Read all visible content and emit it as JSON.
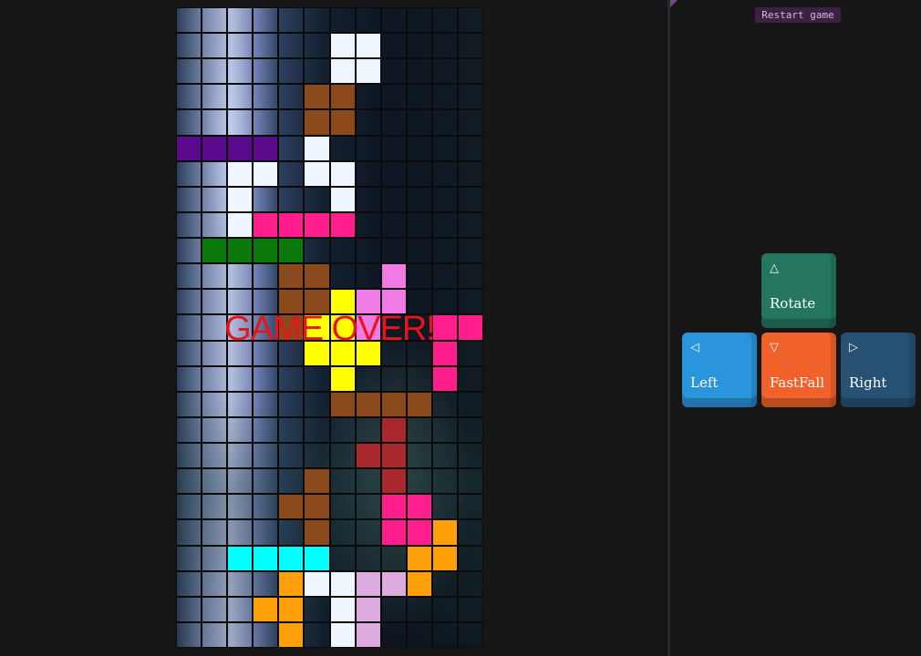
{
  "board": {
    "cols": 12,
    "rows": 25,
    "palette": {
      "W": "#f0f6ff",
      "B": "#8c4a1c",
      "P": "#5c0a8c",
      "M": "#ff1e8c",
      "G": "#0a780a",
      "V": "#f07ae6",
      "Y": "#ffff00",
      "R": "#a8282d",
      "C": "#00ffff",
      "O": "#ffa00a",
      "L": "#dcaadc"
    },
    "layout": [
      "............",
      "......WW....",
      "......WW....",
      ".....BB.....",
      ".....BB.....",
      "PPPP.W......",
      "..WW.WW.....",
      "..W...W.....",
      "..WMMMM.....",
      ".GGGG.......",
      "....BB..V...",
      "....BBYVV...",
      "....BYYV..MM",
      ".....YYY..M.",
      "......Y...M.",
      "......BBBB..",
      "........R...",
      ".......RR...",
      ".....B..R...",
      "....BB..MM..",
      ".....B..MMO.",
      "..CCCC...OO.",
      "....OWWLLO..",
      "...OO.WL....",
      "....O.WL...."
    ],
    "overlay_text": "GAME OVER!"
  },
  "controls": {
    "restart_label": "Restart game",
    "rotate": {
      "glyph": "△",
      "label": "Rotate"
    },
    "left": {
      "glyph": "◁",
      "label": "Left"
    },
    "fastfall": {
      "glyph": "▽",
      "label": "FastFall"
    },
    "right": {
      "glyph": "▷",
      "label": "Right"
    }
  }
}
